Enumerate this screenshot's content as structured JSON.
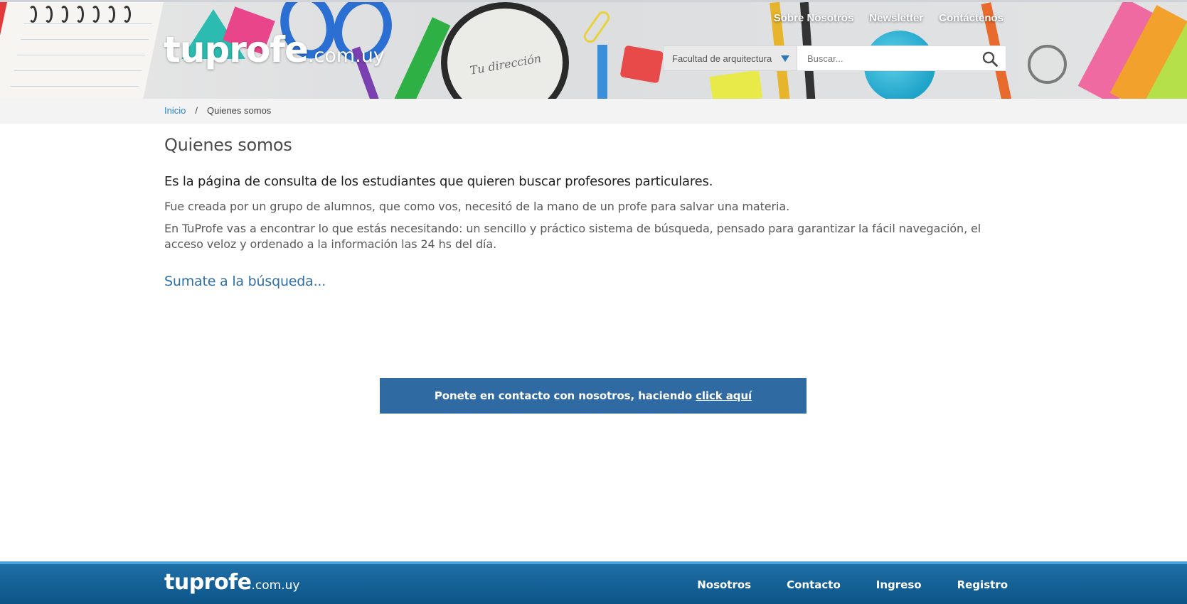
{
  "header": {
    "logo_main": "tuprofe",
    "logo_domain": ".com.uy",
    "banner_text": "Tu dirección",
    "nav": [
      "Sobre Nosotros",
      "Newsletter",
      "Contáctenos"
    ],
    "faculty_select": "Facultad de arquitectura",
    "search_placeholder": "Buscar..."
  },
  "breadcrumb": {
    "home": "Inicio",
    "separator": "/",
    "current": "Quienes somos"
  },
  "main": {
    "title": "Quienes somos",
    "lead": "Es la página de consulta de los estudiantes que quieren buscar profesores particulares.",
    "paragraphs": [
      "Fue creada por un grupo de alumnos, que como vos, necesitó de la mano de un profe para salvar una materia.",
      "En TuProfe vas a encontrar lo que estás necesitando: un sencillo y práctico sistema de búsqueda, pensado para garantizar la fácil navegación, el acceso veloz y ordenado a la información las 24 hs del día."
    ],
    "join_link": "Sumate a la búsqueda...",
    "contact_text": "Ponete en contacto con nosotros, haciendo",
    "contact_link": "click aquí"
  },
  "footer": {
    "logo_main": "tuprofe",
    "logo_domain": ".com.uy",
    "nav": [
      "Nosotros",
      "Contacto",
      "Ingreso",
      "Registro"
    ]
  },
  "colors": {
    "accent_blue": "#2f6aa3",
    "link_blue": "#2b86c4",
    "footer_blue": "#0b5487"
  },
  "icons": {
    "select_arrow": "triangle-down-icon",
    "search": "search-icon"
  }
}
